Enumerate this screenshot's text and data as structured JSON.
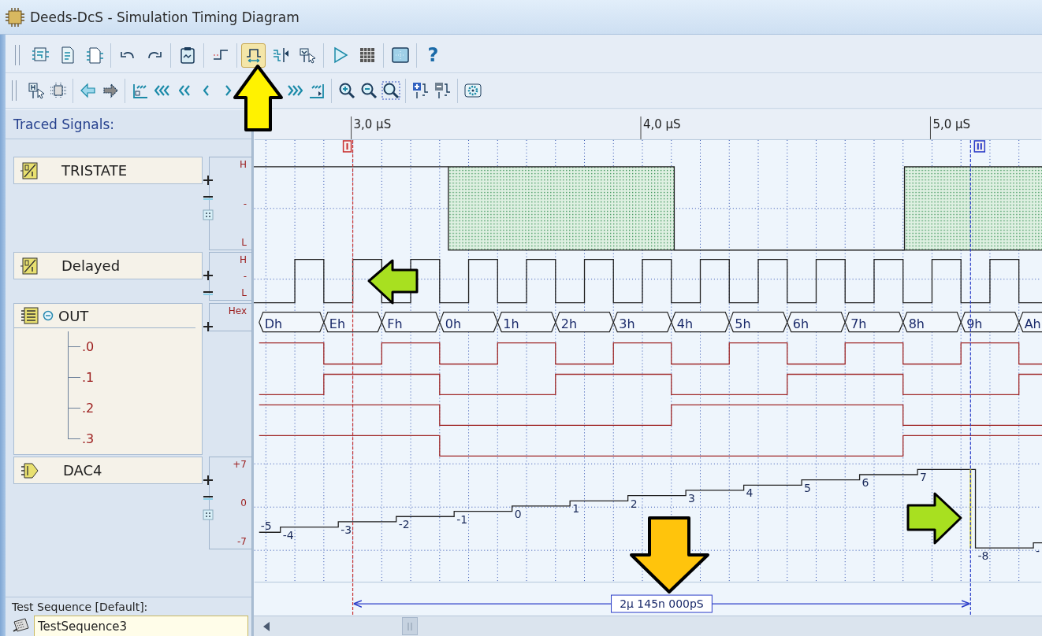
{
  "window": {
    "title": "Deeds-DcS  -  Simulation Timing Diagram"
  },
  "toolbars": [
    {
      "groups": [
        [
          {
            "kind": "circuit",
            "selected": false
          },
          {
            "kind": "document",
            "selected": false
          },
          {
            "kind": "document-chip",
            "selected": false
          }
        ],
        [
          {
            "kind": "undo",
            "selected": false
          },
          {
            "kind": "redo",
            "selected": false
          }
        ],
        [
          {
            "kind": "clipboard",
            "selected": false
          }
        ],
        [
          {
            "kind": "step-edge",
            "selected": false
          }
        ],
        [
          {
            "kind": "pulse-measure",
            "selected": true
          },
          {
            "kind": "cursor-lines",
            "selected": false
          },
          {
            "kind": "probe-pointer",
            "selected": false
          }
        ],
        [
          {
            "kind": "play",
            "selected": false
          },
          {
            "kind": "grid",
            "selected": false
          }
        ],
        [
          {
            "kind": "panel",
            "selected": false
          }
        ],
        [
          {
            "kind": "help",
            "glyph": "?",
            "selected": false
          }
        ]
      ]
    },
    {
      "groups": [
        [
          {
            "kind": "probe-h",
            "selected": false
          },
          {
            "kind": "chip-dots",
            "selected": false
          }
        ],
        [
          {
            "kind": "arrow-left",
            "selected": false
          },
          {
            "kind": "arrow-right",
            "selected": false
          }
        ],
        [
          {
            "kind": "jump-start",
            "selected": false
          },
          {
            "kind": "triple-left",
            "selected": false
          },
          {
            "kind": "double-left",
            "selected": false
          },
          {
            "kind": "single-left",
            "selected": false
          },
          {
            "kind": "single-right",
            "selected": false
          },
          {
            "kind": "triple-right",
            "selected": false
          },
          {
            "kind": "jump-end",
            "selected": false
          }
        ],
        [
          {
            "kind": "zoom-in",
            "selected": false
          },
          {
            "kind": "zoom-out",
            "selected": false
          },
          {
            "kind": "zoom-fit",
            "selected": false
          }
        ],
        [
          {
            "kind": "add-signal",
            "selected": false
          },
          {
            "kind": "remove-signal",
            "selected": false
          }
        ],
        [
          {
            "kind": "gear-board",
            "selected": false
          }
        ]
      ]
    }
  ],
  "traced_signals": {
    "title": "Traced Signals:",
    "signals": [
      {
        "kind": "tristate",
        "name": "TRISTATE",
        "scale": [
          "H",
          "-",
          "L"
        ],
        "controls": [
          {
            "kind": "expand"
          },
          {
            "kind": "shrink"
          },
          {
            "kind": "fit"
          }
        ]
      },
      {
        "kind": "clock",
        "name": "Delayed",
        "scale": [
          "H",
          "-",
          "L"
        ],
        "controls": [
          {
            "kind": "expand"
          },
          {
            "kind": "shrink"
          }
        ]
      },
      {
        "kind": "bus",
        "name": "OUT",
        "expanded": true,
        "scale": [
          "Hex"
        ],
        "controls": [
          {
            "kind": "expand"
          }
        ],
        "children": [
          {
            "name": ".0"
          },
          {
            "name": ".1"
          },
          {
            "name": ".2"
          },
          {
            "name": ".3"
          }
        ]
      },
      {
        "kind": "dac",
        "name": "DAC4",
        "scale": [
          "+7",
          "0",
          "-7"
        ],
        "controls": [
          {
            "kind": "expand"
          },
          {
            "kind": "shrink"
          },
          {
            "kind": "fit"
          }
        ]
      }
    ]
  },
  "timeline": {
    "ruler": [
      "3,0 µS",
      "4,0 µS",
      "5,0 µS"
    ],
    "bus_values": [
      "Dh",
      "Eh",
      "Fh",
      "0h",
      "1h",
      "2h",
      "3h",
      "4h",
      "5h",
      "6h",
      "7h",
      "8h",
      "9h",
      "Ah"
    ],
    "dac_values": [
      "-5",
      "-4",
      "-3",
      "-2",
      "-1",
      "0",
      "1",
      "2",
      "3",
      "4",
      "5",
      "6",
      "7",
      "-8",
      "-"
    ],
    "cursors": [
      {
        "label": "I",
        "color": "#c83232"
      },
      {
        "label": "II",
        "color": "#2a3cc8"
      }
    ],
    "measurement": "2µ 145n 000pS"
  },
  "test_sequence": {
    "label": "Test Sequence [Default]:",
    "value": "TestSequence3"
  }
}
